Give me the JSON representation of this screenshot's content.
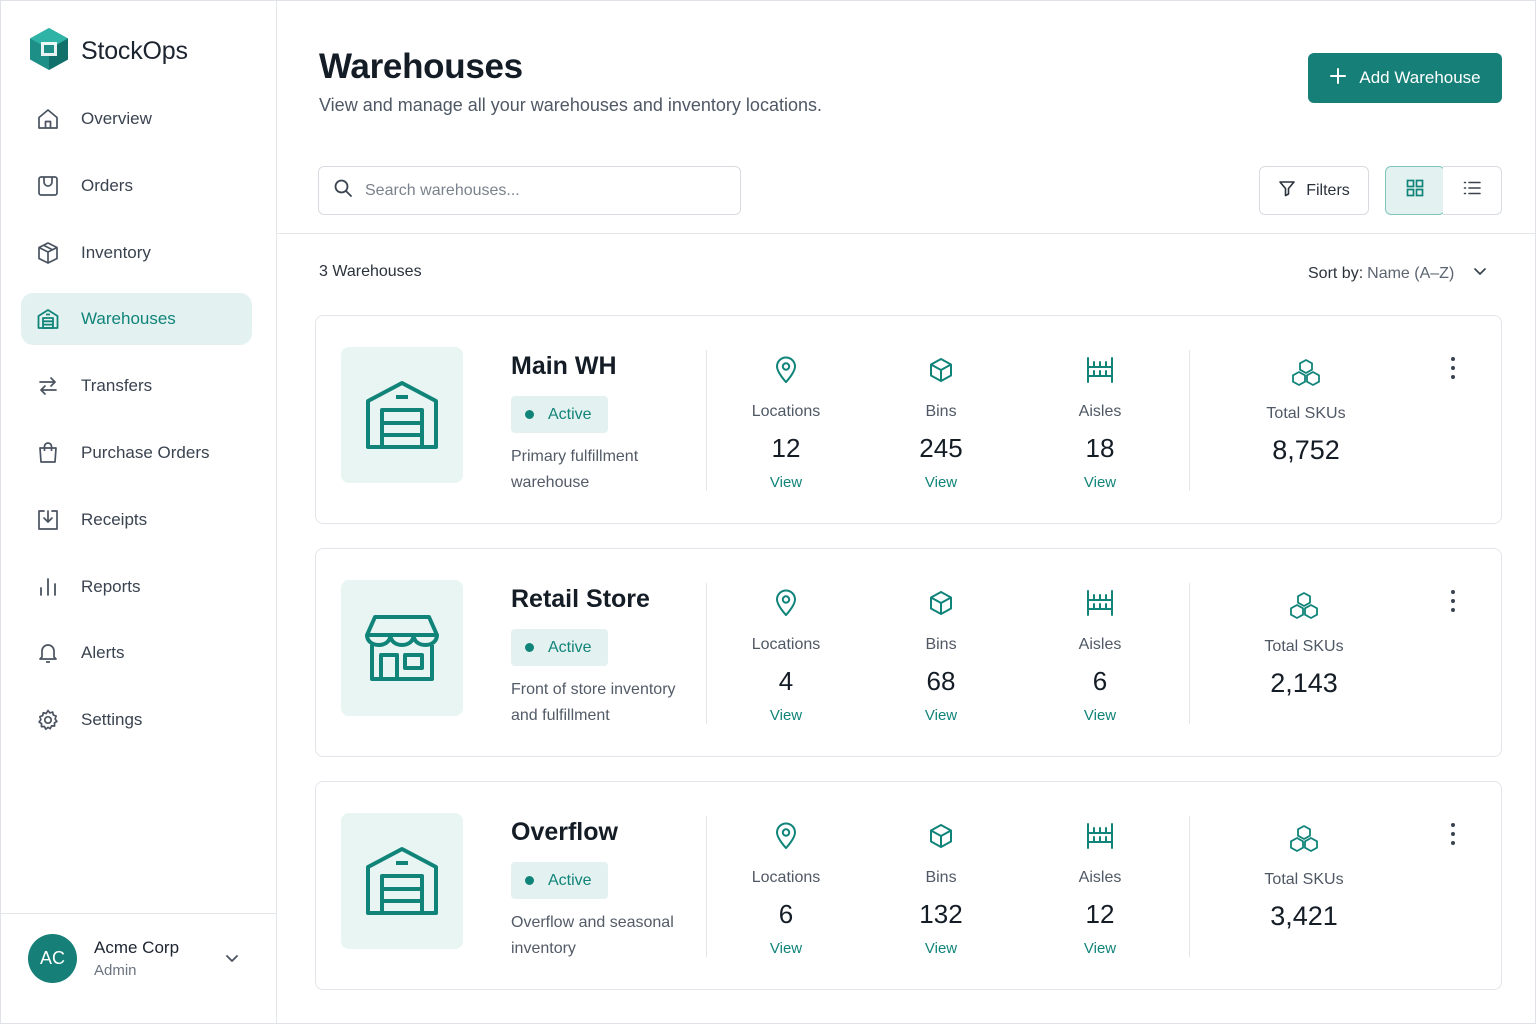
{
  "brand": {
    "name": "StockOps"
  },
  "colors": {
    "accent": "#167f77",
    "accent_light": "#e3f2f0",
    "text": "#1c2430"
  },
  "sidebar": {
    "items": [
      {
        "label": "Overview",
        "icon": "home-icon"
      },
      {
        "label": "Orders",
        "icon": "orders-icon"
      },
      {
        "label": "Inventory",
        "icon": "box-icon"
      },
      {
        "label": "Warehouses",
        "icon": "warehouse-icon",
        "active": true
      },
      {
        "label": "Transfers",
        "icon": "arrows-swap-icon"
      },
      {
        "label": "Purchase Orders",
        "icon": "shopping-bag-icon"
      },
      {
        "label": "Receipts",
        "icon": "download-tray-icon"
      },
      {
        "label": "Reports",
        "icon": "bar-chart-icon"
      },
      {
        "label": "Alerts",
        "icon": "bell-icon"
      },
      {
        "label": "Settings",
        "icon": "gear-icon"
      }
    ],
    "account": {
      "initials": "AC",
      "name": "Acme Corp",
      "role": "Admin"
    }
  },
  "header": {
    "title": "Warehouses",
    "subtitle": "View and manage all your warehouses and inventory locations.",
    "add_button": "Add Warehouse"
  },
  "toolbar": {
    "search_placeholder": "Search warehouses...",
    "search_value": "",
    "filters_label": "Filters",
    "view_mode": "grid"
  },
  "list": {
    "count_label": "3 Warehouses",
    "sort_prefix": "Sort by:",
    "sort_value": "Name (A–Z)"
  },
  "warehouses": [
    {
      "name": "Main WH",
      "status": "Active",
      "description": "Primary fulfillment warehouse",
      "icon": "warehouse-icon",
      "locations_label": "Locations",
      "locations": "12",
      "bins_label": "Bins",
      "bins": "245",
      "aisles_label": "Aisles",
      "aisles": "18",
      "skus_label": "Total SKUs",
      "skus": "8,752",
      "view_label": "View"
    },
    {
      "name": "Retail Store",
      "status": "Active",
      "description": "Front of store inventory and fulfillment",
      "icon": "storefront-icon",
      "locations_label": "Locations",
      "locations": "4",
      "bins_label": "Bins",
      "bins": "68",
      "aisles_label": "Aisles",
      "aisles": "6",
      "skus_label": "Total SKUs",
      "skus": "2,143",
      "view_label": "View"
    },
    {
      "name": "Overflow",
      "status": "Active",
      "description": "Overflow and seasonal inventory",
      "icon": "warehouse-icon",
      "locations_label": "Locations",
      "locations": "6",
      "bins_label": "Bins",
      "bins": "132",
      "aisles_label": "Aisles",
      "aisles": "12",
      "skus_label": "Total SKUs",
      "skus": "3,421",
      "view_label": "View"
    }
  ]
}
